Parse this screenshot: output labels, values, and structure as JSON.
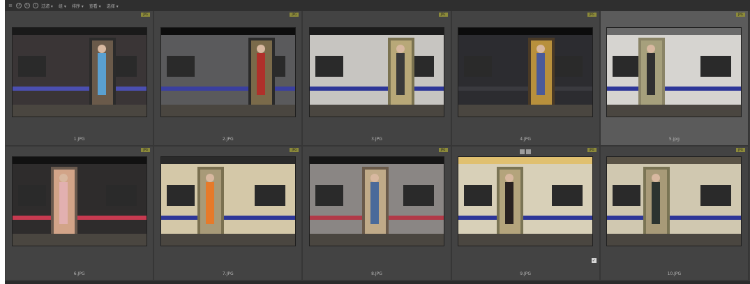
{
  "toolbar": {
    "menus": [
      "过滤 ▾",
      "组 ▾",
      "排序 ▾",
      "查看 ▾",
      "选择 ▾"
    ]
  },
  "badge_text": "JPG",
  "colors": {
    "panel": "#3b3b3b",
    "cell": "#434343",
    "selected_cell": "#5b5b5b",
    "badge": "#8c8a3a"
  },
  "thumbnails": [
    {
      "filename": "1.JPG",
      "type": "JPG",
      "selected": false,
      "photo": "silver-train-open-door-passengers"
    },
    {
      "filename": "2.JPG",
      "type": "JPG",
      "selected": false,
      "photo": "silver-train-door-man-red-jacket"
    },
    {
      "filename": "3.JPG",
      "type": "JPG",
      "selected": false,
      "photo": "silver-train-door-woman-child"
    },
    {
      "filename": "4.JPG",
      "type": "JPG",
      "selected": false,
      "photo": "dark-train-door-man-leaping"
    },
    {
      "filename": "5.jpg",
      "type": "JPG",
      "selected": true,
      "photo": "silver-train-door-passenger-seated"
    },
    {
      "filename": "6.JPG",
      "type": "JPG",
      "selected": false,
      "photo": "train-door-woman-crouching"
    },
    {
      "filename": "7.JPG",
      "type": "JPG",
      "selected": false,
      "photo": "cream-train-door-passengers"
    },
    {
      "filename": "8.JPG",
      "type": "JPG",
      "selected": false,
      "photo": "train-door-mother-children"
    },
    {
      "filename": "9.JPG",
      "type": "JPG",
      "selected": false,
      "photo": "platform-walkers-train-door",
      "checked": true
    },
    {
      "filename": "10.JPG",
      "type": "JPG",
      "selected": false,
      "photo": "train-door-men-walking-platform"
    }
  ]
}
